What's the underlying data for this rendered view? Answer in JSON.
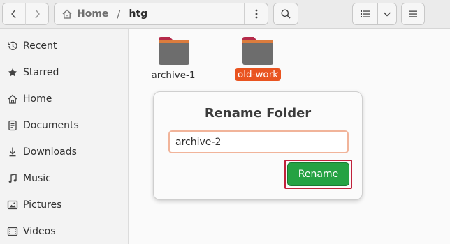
{
  "header": {
    "path": {
      "home_label": "Home",
      "separator": "/",
      "current": "htg"
    }
  },
  "sidebar": {
    "items": [
      {
        "label": "Recent",
        "icon": "clock-icon"
      },
      {
        "label": "Starred",
        "icon": "star-icon"
      },
      {
        "label": "Home",
        "icon": "home-icon"
      },
      {
        "label": "Documents",
        "icon": "document-icon"
      },
      {
        "label": "Downloads",
        "icon": "download-icon"
      },
      {
        "label": "Music",
        "icon": "music-icon"
      },
      {
        "label": "Pictures",
        "icon": "pictures-icon"
      },
      {
        "label": "Videos",
        "icon": "video-icon"
      }
    ]
  },
  "content": {
    "folders": [
      {
        "name": "archive-1",
        "selected": false
      },
      {
        "name": "old-work",
        "selected": true
      }
    ]
  },
  "rename_popover": {
    "title": "Rename Folder",
    "input_value": "archive-2",
    "button_label": "Rename"
  },
  "colors": {
    "accent": "#e95420",
    "rename_button": "#25a243",
    "highlight_border": "#c0223b",
    "folder_body": "#6d6d6d",
    "folder_tab": "#b52a4a"
  }
}
